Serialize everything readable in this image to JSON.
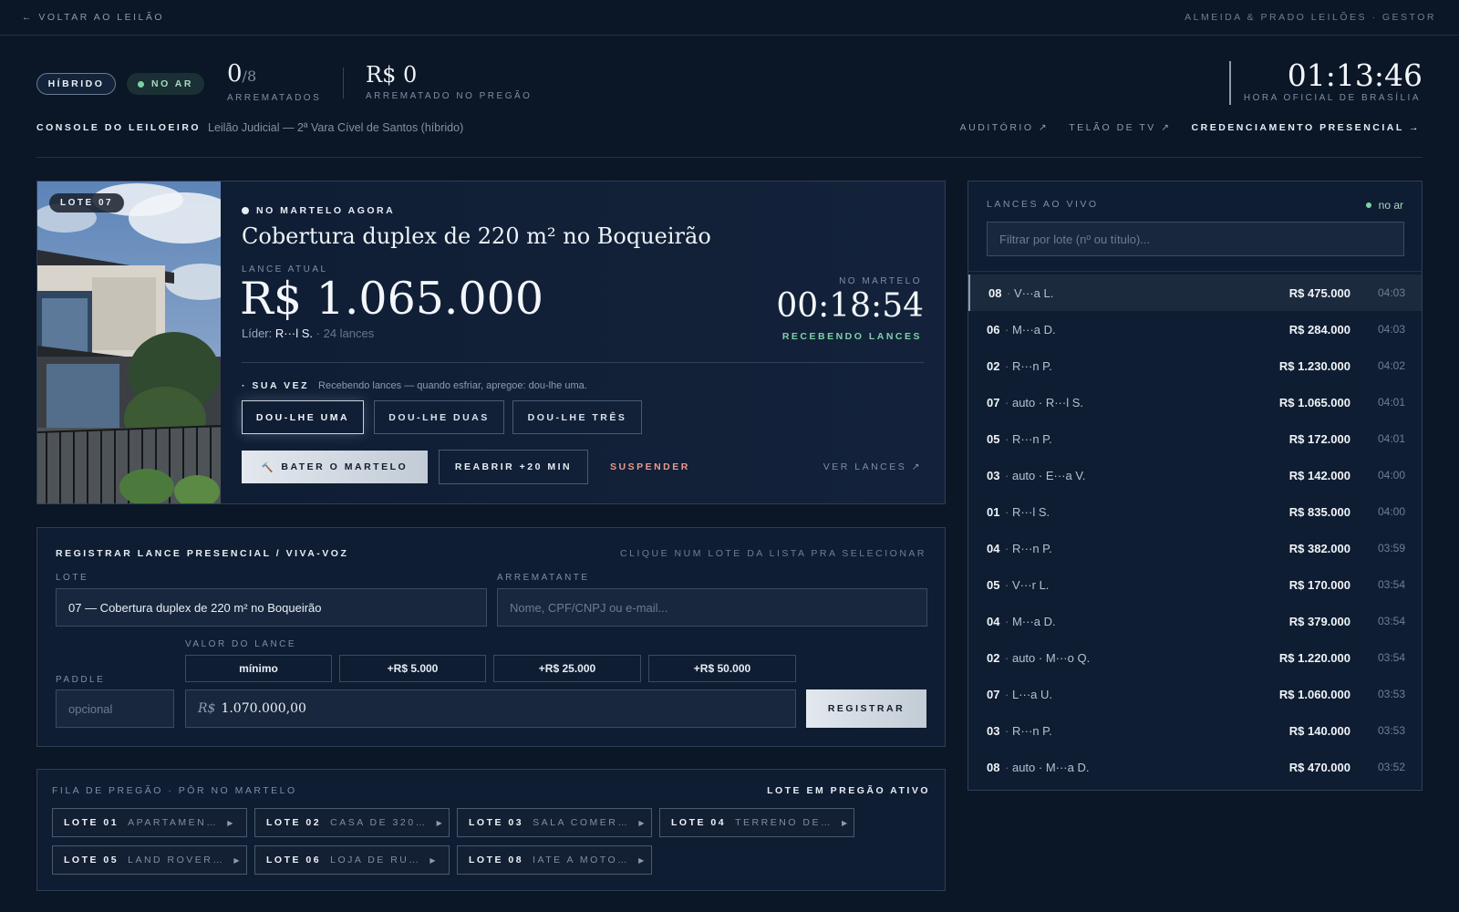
{
  "topbar": {
    "back_label": "← VOLTAR AO LEILÃO",
    "brand": "ALMEIDA & PRADO LEILÕES · GESTOR"
  },
  "header": {
    "mode_pill": "HÍBRIDO",
    "live_pill": "NO AR",
    "sold_count": "0",
    "sold_total": "/8",
    "sold_label": "ARREMATADOS",
    "sold_value": "R$ 0",
    "sold_value_label": "ARREMATADO NO PREGÃO",
    "clock": "01:13:46",
    "clock_label": "HORA OFICIAL DE BRASÍLIA",
    "console_label": "CONSOLE DO LEILOEIRO",
    "console_sub": "Leilão Judicial — 2ª Vara Cível de Santos (híbrido)",
    "nav": [
      "AUDITÓRIO ↗",
      "TELÃO DE TV ↗",
      "CREDENCIAMENTO PRESENCIAL →"
    ]
  },
  "hero": {
    "lot_badge": "LOTE 07",
    "now_label": "NO MARTELO AGORA",
    "title": "Cobertura duplex de 220 m² no Boqueirão",
    "current_label": "LANCE ATUAL",
    "current_value": "R$ 1.065.000",
    "leader_prefix": "Líder: ",
    "leader_name": "R···l S.",
    "leader_bids": " · 24 lances",
    "hammer_label": "NO MARTELO",
    "hammer_time": "00:18:54",
    "status": "RECEBENDO LANCES",
    "turn_label": "SUA VEZ",
    "turn_text": "Recebendo lances — quando esfriar, apregoe: dou-lhe uma.",
    "dou_buttons": [
      "DOU-LHE UMA",
      "DOU-LHE DUAS",
      "DOU-LHE TRÊS"
    ],
    "bater_label": "BATER O MARTELO",
    "reabrir_label": "REABRIR +20 MIN",
    "suspender_label": "SUSPENDER",
    "ver_lances_label": "VER LANCES ↗"
  },
  "register": {
    "title": "REGISTRAR LANCE PRESENCIAL / VIVA-VOZ",
    "hint": "CLIQUE NUM LOTE DA LISTA PRA SELECIONAR",
    "lote_label": "LOTE",
    "lote_value": "07 — Cobertura duplex de 220 m² no Boqueirão",
    "arrematante_label": "ARREMATANTE",
    "arrematante_placeholder": "Nome, CPF/CNPJ ou e-mail...",
    "valor_label": "VALOR DO LANCE",
    "paddle_label": "PADDLE",
    "paddle_placeholder": "opcional",
    "quick_buttons": [
      "mínimo",
      "+R$ 5.000",
      "+R$ 25.000",
      "+R$ 50.000"
    ],
    "valor_prefix": "R$",
    "valor_value": "1.070.000,00",
    "registrar_label": "REGISTRAR"
  },
  "queue": {
    "title": "FILA DE PREGÃO · PÔR NO MARTELO",
    "active_label": "LOTE EM PREGÃO ATIVO",
    "items": [
      {
        "lot": "LOTE 01",
        "name": "APARTAMEN…"
      },
      {
        "lot": "LOTE 02",
        "name": "CASA DE 320…"
      },
      {
        "lot": "LOTE 03",
        "name": "SALA COMER…"
      },
      {
        "lot": "LOTE 04",
        "name": "TERRENO DE…"
      },
      {
        "lot": "LOTE 05",
        "name": "LAND ROVER…"
      },
      {
        "lot": "LOTE 06",
        "name": "LOJA DE RU…"
      },
      {
        "lot": "LOTE 08",
        "name": "IATE A MOTO…"
      }
    ]
  },
  "bids": {
    "title": "LANCES AO VIVO",
    "live_label": "no ar",
    "filter_placeholder": "Filtrar por lote (nº ou título)...",
    "rows": [
      {
        "lot": "08",
        "who": "V···a L.",
        "amount": "R$ 475.000",
        "time": "04:03"
      },
      {
        "lot": "06",
        "who": "M···a D.",
        "amount": "R$ 284.000",
        "time": "04:03"
      },
      {
        "lot": "02",
        "who": "R···n P.",
        "amount": "R$ 1.230.000",
        "time": "04:02"
      },
      {
        "lot": "07",
        "who": "auto · R···l S.",
        "amount": "R$ 1.065.000",
        "time": "04:01"
      },
      {
        "lot": "05",
        "who": "R···n P.",
        "amount": "R$ 172.000",
        "time": "04:01"
      },
      {
        "lot": "03",
        "who": "auto · E···a V.",
        "amount": "R$ 142.000",
        "time": "04:00"
      },
      {
        "lot": "01",
        "who": "R···l S.",
        "amount": "R$ 835.000",
        "time": "04:00"
      },
      {
        "lot": "04",
        "who": "R···n P.",
        "amount": "R$ 382.000",
        "time": "03:59"
      },
      {
        "lot": "05",
        "who": "V···r L.",
        "amount": "R$ 170.000",
        "time": "03:54"
      },
      {
        "lot": "04",
        "who": "M···a D.",
        "amount": "R$ 379.000",
        "time": "03:54"
      },
      {
        "lot": "02",
        "who": "auto · M···o Q.",
        "amount": "R$ 1.220.000",
        "time": "03:54"
      },
      {
        "lot": "07",
        "who": "L···a U.",
        "amount": "R$ 1.060.000",
        "time": "03:53"
      },
      {
        "lot": "03",
        "who": "R···n P.",
        "amount": "R$ 140.000",
        "time": "03:53"
      },
      {
        "lot": "08",
        "who": "auto · M···a D.",
        "amount": "R$ 470.000",
        "time": "03:52"
      }
    ]
  }
}
